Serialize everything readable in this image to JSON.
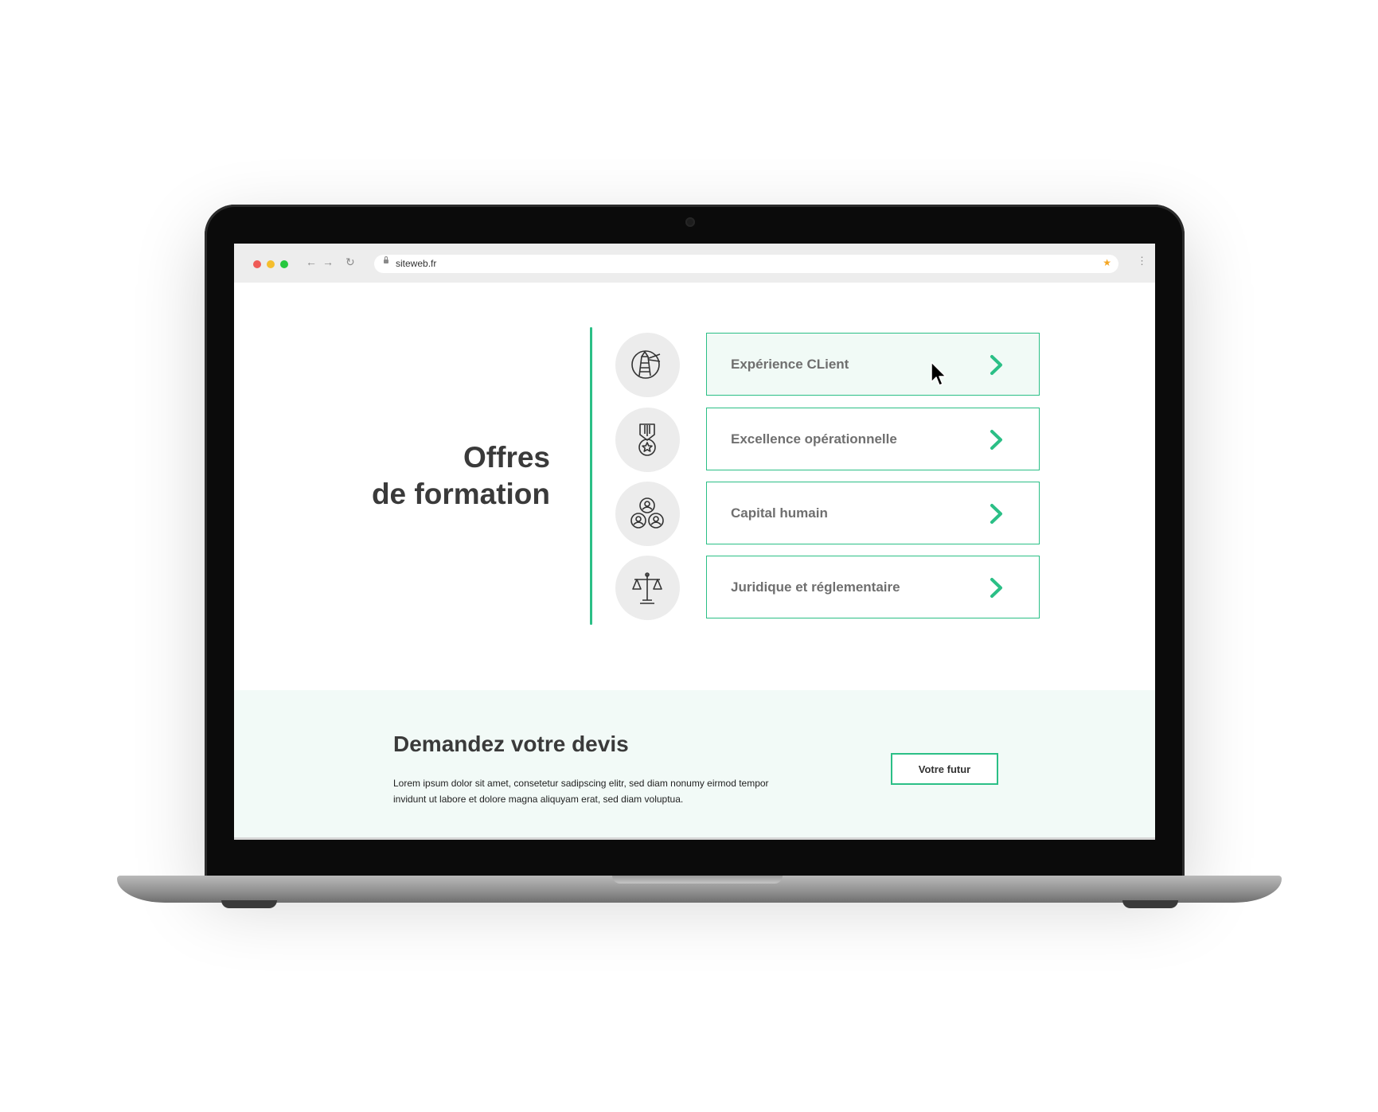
{
  "browser": {
    "url": "siteweb.fr",
    "traffic_lights": [
      "#ef5b57",
      "#f5be2e",
      "#27c83f"
    ]
  },
  "page": {
    "title_line1": "Offres",
    "title_line2": "de formation"
  },
  "offers": [
    {
      "label": "Expérience CLient",
      "icon": "lighthouse-icon",
      "active": true
    },
    {
      "label": "Excellence opérationnelle",
      "icon": "medal-icon",
      "active": false
    },
    {
      "label": "Capital humain",
      "icon": "people-network-icon",
      "active": false
    },
    {
      "label": "Juridique et réglementaire",
      "icon": "scales-icon",
      "active": false
    }
  ],
  "cta": {
    "title": "Demandez votre devis",
    "text": "Lorem ipsum dolor sit amet, consetetur sadipscing elitr, sed diam nonumy eirmod tempor invidunt ut labore et dolore magna aliquyam erat, sed diam voluptua.",
    "button_label": "Votre futur"
  },
  "colors": {
    "accent": "#2bbf86",
    "title_text": "#3a3a3a",
    "card_label": "#6f6f6f",
    "cta_background": "#f2faf7"
  }
}
